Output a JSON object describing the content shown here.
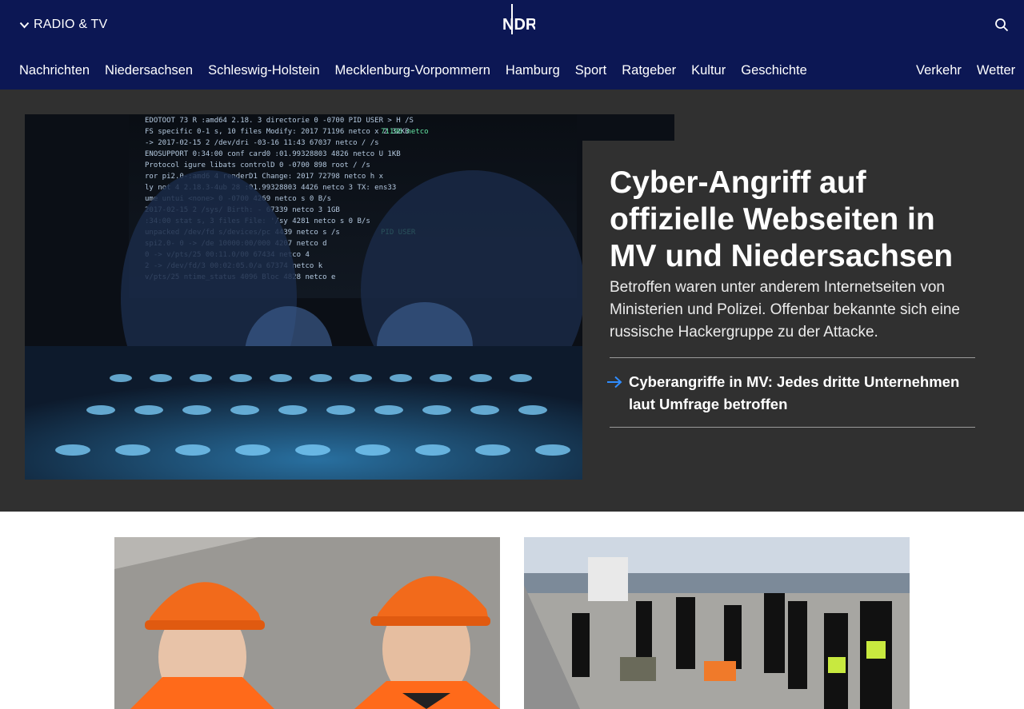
{
  "header": {
    "radio_tv_label": "RADIO & TV",
    "logo_text": "NDR",
    "nav_main": [
      "Nachrichten",
      "Niedersachsen",
      "Schleswig-Holstein",
      "Mecklenburg-Vorpommern",
      "Hamburg",
      "Sport",
      "Ratgeber",
      "Kultur",
      "Geschichte"
    ],
    "nav_secondary": [
      "Verkehr",
      "Wetter"
    ]
  },
  "teaser": {
    "title": "Cyber-Angriff auf offizielle Webseiten in MV und Niedersachsen",
    "summary": "Betroffen waren unter anderem Internetseiten von Ministerien und Polizei. Offenbar bekannte sich eine russische Hackergruppe zu der Attacke.",
    "related_link": "Cyberangriffe in MV: Jedes dritte Unternehmen laut Umfrage betroffen"
  },
  "cards": [
    {
      "image": "two men in orange hard hats and safety vests"
    },
    {
      "image": "police officers with protesters sitting on a bridge road"
    }
  ],
  "colors": {
    "header_bg": "#0c1754",
    "teaser_bg": "#303030",
    "link_arrow": "#2f8cff"
  },
  "icons": {
    "radio_tv": "chevron-down-icon",
    "search": "search-icon",
    "related": "arrow-right-icon"
  }
}
